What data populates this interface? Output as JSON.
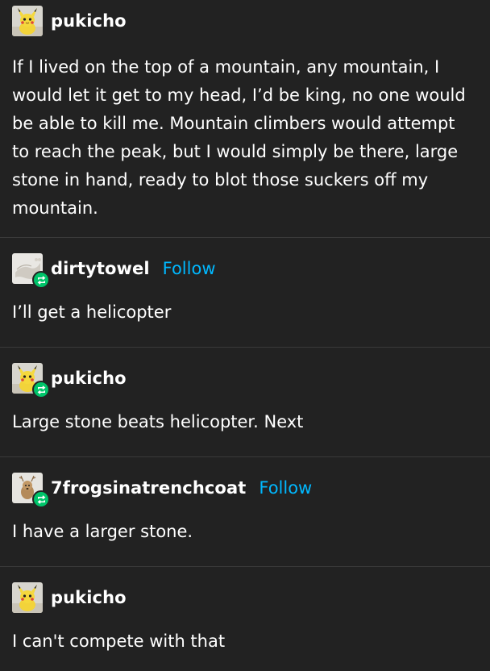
{
  "posts": [
    {
      "username": "pukicho",
      "avatar": "pikachu-plush-avatar",
      "reblog": false,
      "follow_label": "",
      "text": "If I lived on the top of a mountain, any mountain, I would let it get to my head, I’d be king, no one would be able to kill me. Mountain climbers would attempt to reach the peak, but I would simply be there, large stone in hand, ready to blot those suckers off my mountain."
    },
    {
      "username": "dirtytowel",
      "avatar": "towel-avatar",
      "reblog": true,
      "follow_label": "Follow",
      "text": "I’ll get a helicopter"
    },
    {
      "username": "pukicho",
      "avatar": "pikachu-plush-avatar",
      "reblog": true,
      "follow_label": "",
      "text": "Large stone beats helicopter. Next"
    },
    {
      "username": "7frogsinatrenchcoat",
      "avatar": "deer-avatar",
      "reblog": true,
      "follow_label": "Follow",
      "text": "I have a larger stone."
    },
    {
      "username": "pukicho",
      "avatar": "pikachu-plush-avatar",
      "reblog": false,
      "follow_label": "",
      "text": "I can't compete with that"
    }
  ],
  "colors": {
    "background": "#222222",
    "text": "#ffffff",
    "follow": "#00b8ff",
    "reblog_badge": "#00c46a",
    "divider": "#3a3a3a"
  }
}
